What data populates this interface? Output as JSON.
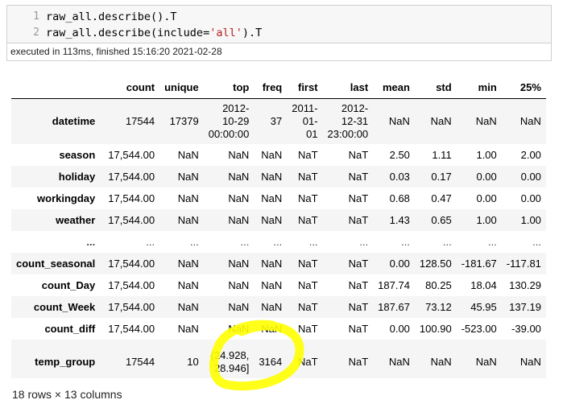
{
  "code_cell": {
    "lines": [
      {
        "num": "1",
        "pre": "raw_all.describe().T",
        "str": "",
        "post": ""
      },
      {
        "num": "2",
        "pre": "raw_all.describe(include=",
        "str": "'all'",
        "post": ").T"
      }
    ],
    "exec_info": "executed in 113ms, finished 15:16:20 2021-02-28"
  },
  "table": {
    "columns": [
      "",
      "count",
      "unique",
      "top",
      "freq",
      "first",
      "last",
      "mean",
      "std",
      "min",
      "25%"
    ],
    "rows": [
      {
        "label": "datetime",
        "cells": [
          "17544",
          "17379",
          [
            "2012-",
            "10-29",
            "00:00:00"
          ],
          "37",
          [
            "2011-",
            "01-",
            "01"
          ],
          [
            "2012-",
            "12-31",
            "23:00:00"
          ],
          "NaN",
          "NaN",
          "NaN",
          "NaN"
        ]
      },
      {
        "label": "season",
        "cells": [
          "17,544.00",
          "NaN",
          "NaN",
          "NaN",
          "NaT",
          "NaT",
          "2.50",
          "1.11",
          "1.00",
          "2.00"
        ]
      },
      {
        "label": "holiday",
        "cells": [
          "17,544.00",
          "NaN",
          "NaN",
          "NaN",
          "NaT",
          "NaT",
          "0.03",
          "0.17",
          "0.00",
          "0.00"
        ]
      },
      {
        "label": "workingday",
        "cells": [
          "17,544.00",
          "NaN",
          "NaN",
          "NaN",
          "NaT",
          "NaT",
          "0.68",
          "0.47",
          "0.00",
          "0.00"
        ]
      },
      {
        "label": "weather",
        "cells": [
          "17,544.00",
          "NaN",
          "NaN",
          "NaN",
          "NaT",
          "NaT",
          "1.43",
          "0.65",
          "1.00",
          "1.00"
        ]
      },
      {
        "label": "...",
        "cells": [
          "...",
          "...",
          "...",
          "...",
          "...",
          "...",
          "...",
          "...",
          "...",
          "..."
        ]
      },
      {
        "label": "count_seasonal",
        "cells": [
          "17,544.00",
          "NaN",
          "NaN",
          "NaN",
          "NaT",
          "NaT",
          "0.00",
          "128.50",
          "-181.67",
          "-117.81"
        ]
      },
      {
        "label": "count_Day",
        "cells": [
          "17,544.00",
          "NaN",
          "NaN",
          "NaN",
          "NaT",
          "NaT",
          "187.74",
          "80.25",
          "18.04",
          "130.29"
        ]
      },
      {
        "label": "count_Week",
        "cells": [
          "17,544.00",
          "NaN",
          "NaN",
          "NaN",
          "NaT",
          "NaT",
          "187.67",
          "73.12",
          "45.95",
          "137.19"
        ]
      },
      {
        "label": "count_diff",
        "cells": [
          "17,544.00",
          "NaN",
          "NaN",
          "NaN",
          "NaT",
          "NaT",
          "0.00",
          "100.90",
          "-523.00",
          "-39.00"
        ]
      },
      {
        "label": "temp_group",
        "cells": [
          "17544",
          "10",
          [
            "(24.928,",
            "28.946]"
          ],
          "3164",
          "NaT",
          "NaT",
          "NaN",
          "NaN",
          "NaN",
          "NaN"
        ]
      }
    ]
  },
  "footer": "18 rows × 13 columns",
  "highlight_color": "#ffff00"
}
